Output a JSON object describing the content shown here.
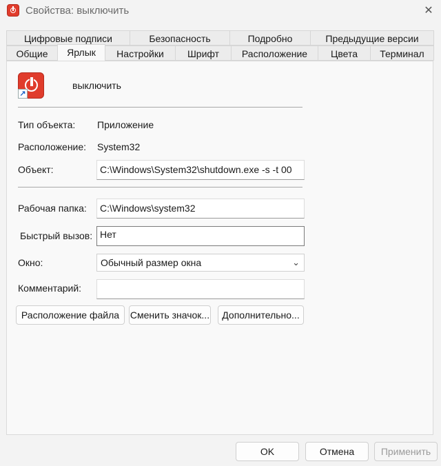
{
  "window": {
    "title": "Свойства: выключить",
    "close_glyph": "✕"
  },
  "tabs_row1": [
    "Цифровые подписи",
    "Безопасность",
    "Подробно",
    "Предыдущие версии"
  ],
  "tabs_row2": [
    "Общие",
    "Ярлык",
    "Настройки",
    "Шрифт",
    "Расположение",
    "Цвета",
    "Терминал"
  ],
  "active_tab": "Ярлык",
  "shortcut": {
    "name": "выключить"
  },
  "fields": {
    "type_label": "Тип объекта:",
    "type_value": "Приложение",
    "location_label": "Расположение:",
    "location_value": "System32",
    "target_label": "Объект:",
    "target_value": "C:\\Windows\\System32\\shutdown.exe -s -t 00",
    "start_in_label": "Рабочая папка:",
    "start_in_value": "C:\\Windows\\system32",
    "hotkey_label": "Быстрый вызов:",
    "hotkey_value": "Нет",
    "run_label": "Окно:",
    "run_value": "Обычный размер окна",
    "comment_label": "Комментарий:",
    "comment_value": ""
  },
  "buttons": {
    "open_location": "Расположение файла",
    "change_icon": "Сменить значок...",
    "advanced": "Дополнительно...",
    "ok": "OK",
    "cancel": "Отмена",
    "apply": "Применить"
  },
  "icons": {
    "app": "power-icon",
    "shortcut_arrow": "shortcut-arrow-icon",
    "chevron": "chevron-down-icon"
  },
  "colors": {
    "icon_red": "#e03c2c"
  }
}
